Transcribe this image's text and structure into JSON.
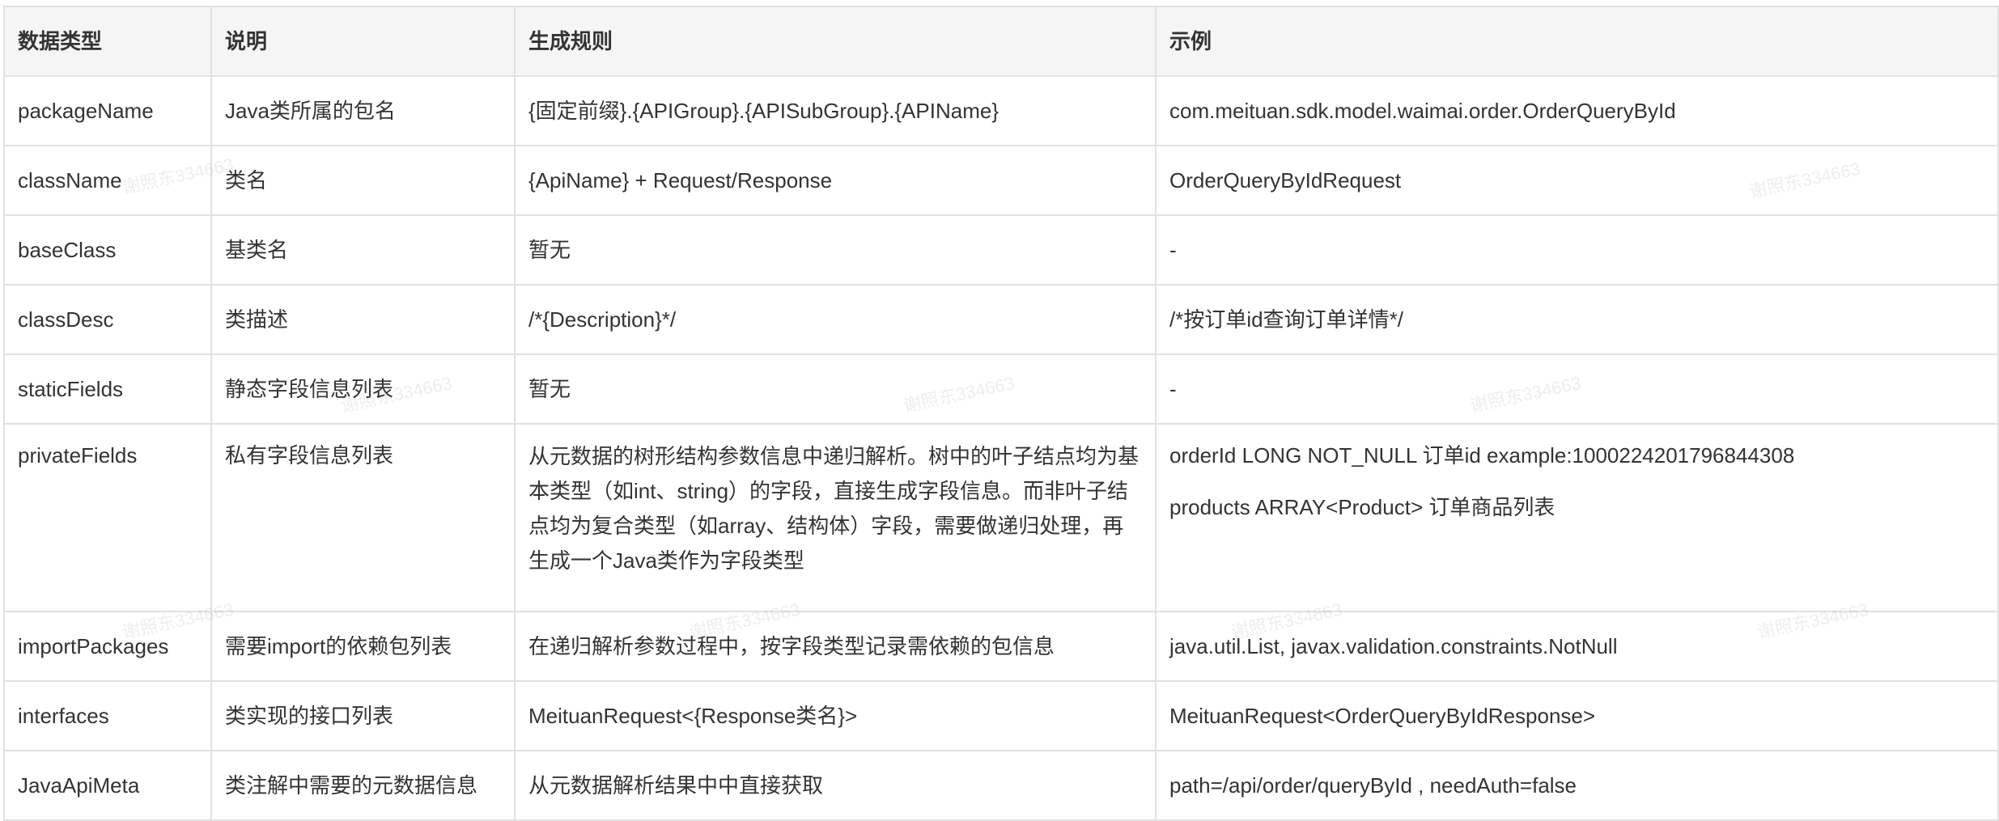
{
  "table": {
    "headers": [
      "数据类型",
      "说明",
      "生成规则",
      "示例"
    ],
    "rows": [
      {
        "type": "packageName",
        "desc": "Java类所属的包名",
        "rule": "{固定前缀}.{APIGroup}.{APISubGroup}.{APIName}",
        "example": [
          "com.meituan.sdk.model.waimai.order.OrderQueryById"
        ]
      },
      {
        "type": "className",
        "desc": "类名",
        "rule": "{ApiName} + Request/Response",
        "example": [
          "OrderQueryByIdRequest"
        ]
      },
      {
        "type": "baseClass",
        "desc": "基类名",
        "rule": "暂无",
        "example": [
          "-"
        ]
      },
      {
        "type": "classDesc",
        "desc": "类描述",
        "rule": "/*{Description}*/",
        "example": [
          "/*按订单id查询订单详情*/"
        ]
      },
      {
        "type": "staticFields",
        "desc": "静态字段信息列表",
        "rule": "暂无",
        "example": [
          "-"
        ]
      },
      {
        "type": "privateFields",
        "desc": "私有字段信息列表",
        "rule": "从元数据的树形结构参数信息中递归解析。树中的叶子结点均为基本类型（如int、string）的字段，直接生成字段信息。而非叶子结点均为复合类型（如array、结构体）字段，需要做递归处理，再生成一个Java类作为字段类型",
        "example": [
          "orderId  LONG NOT_NULL 订单id  example:1000224201796844308",
          "products  ARRAY<Product>  订单商品列表"
        ]
      },
      {
        "type": "importPackages",
        "desc": "需要import的依赖包列表",
        "rule": "在递归解析参数过程中，按字段类型记录需依赖的包信息",
        "example": [
          "java.util.List,  javax.validation.constraints.NotNull"
        ]
      },
      {
        "type": "interfaces",
        "desc": "类实现的接口列表",
        "rule": "MeituanRequest<{Response类名}>",
        "example": [
          "MeituanRequest<OrderQueryByIdResponse>"
        ]
      },
      {
        "type": "JavaApiMeta",
        "desc": "类注解中需要的元数据信息",
        "rule": "从元数据解析结果中中直接获取",
        "example": [
          "path=/api/order/queryById , needAuth=false"
        ]
      }
    ]
  },
  "watermark": "谢照东334663"
}
